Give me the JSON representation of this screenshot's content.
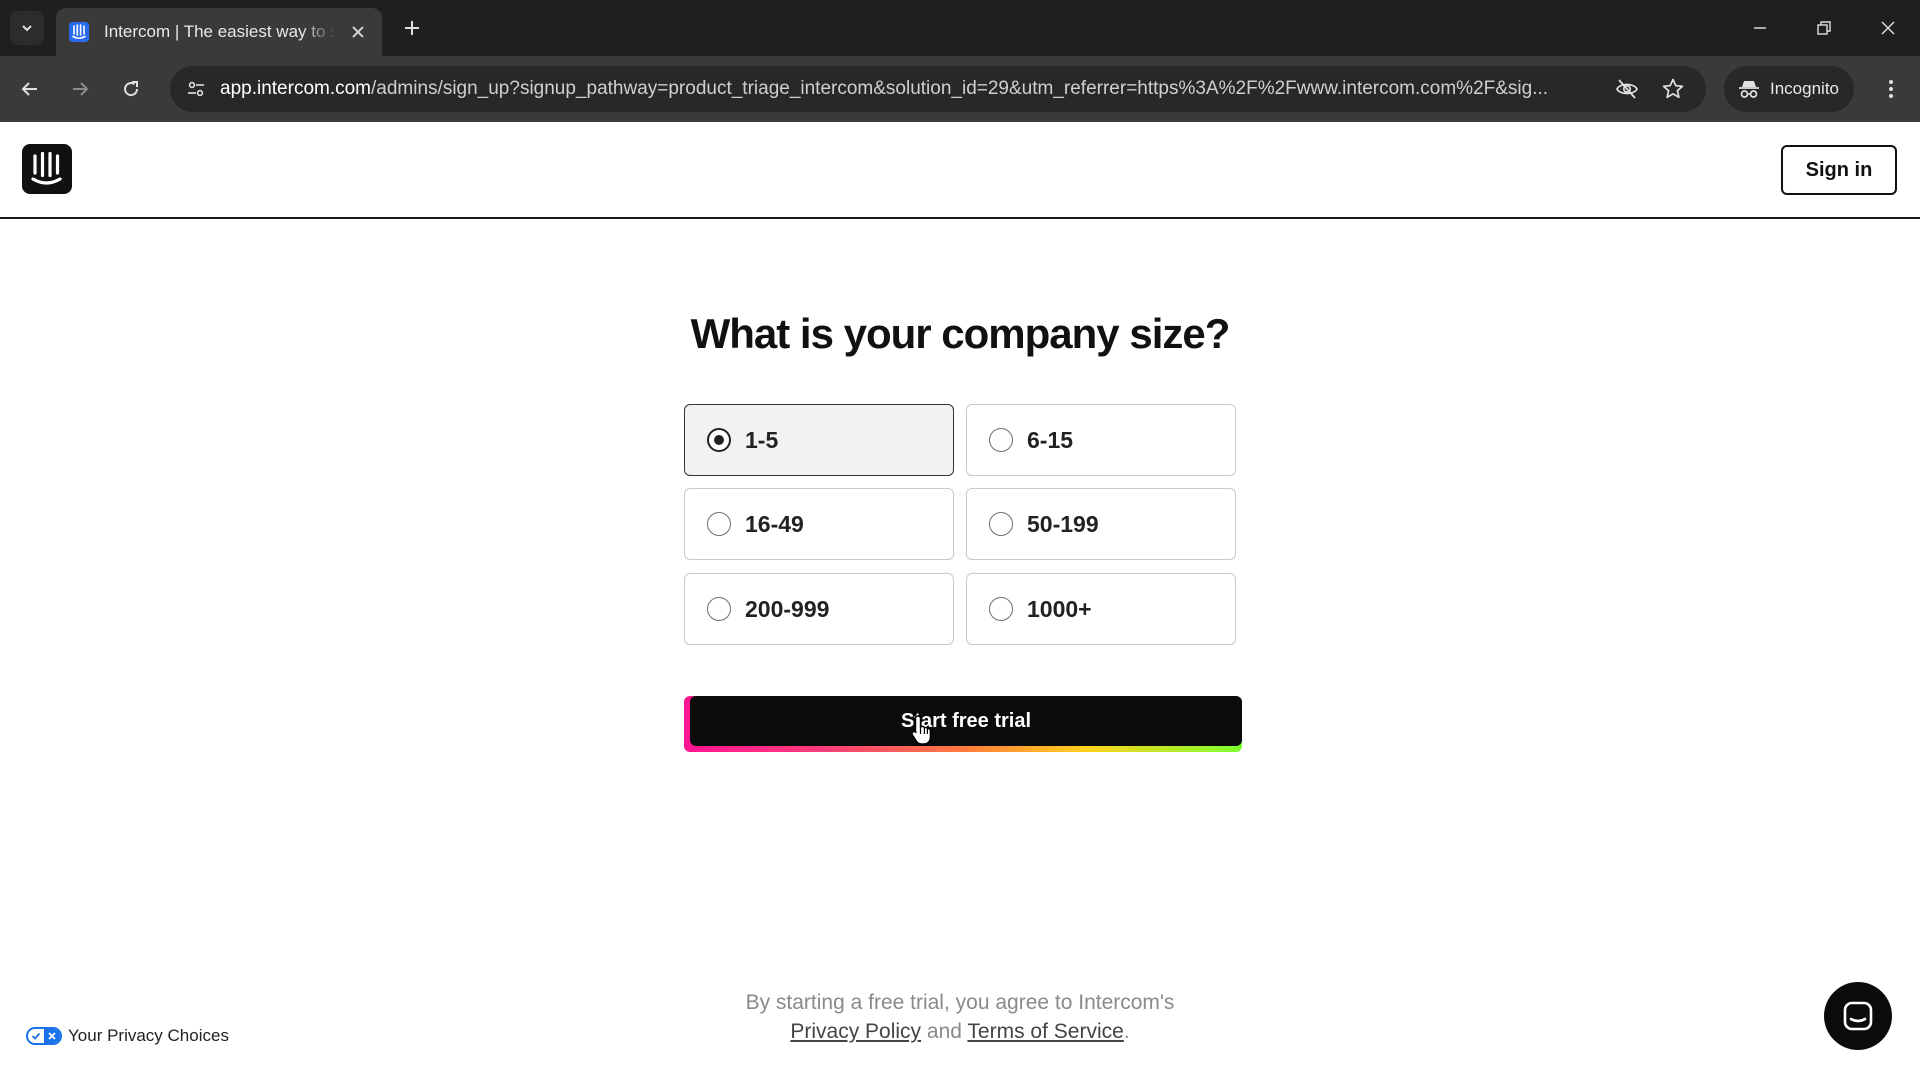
{
  "browser": {
    "tab": {
      "title": "Intercom | The easiest way to scale"
    },
    "url": {
      "host": "app.intercom.com",
      "path": "/admins/sign_up?signup_pathway=product_triage_intercom&solution_id=29&utm_referrer=https%3A%2F%2Fwww.intercom.com%2F&sig..."
    },
    "incognito_label": "Incognito",
    "icons": [
      "tab-search-icon",
      "intercom-favicon-icon",
      "close-icon",
      "plus-icon",
      "minimize-icon",
      "restore-icon",
      "back-icon",
      "forward-icon",
      "reload-icon",
      "site-info-icon",
      "eye-off-icon",
      "star-icon",
      "incognito-icon",
      "kebab-menu-icon"
    ]
  },
  "header": {
    "signin_label": "Sign in"
  },
  "main": {
    "question": "What is your company size?",
    "options": [
      {
        "label": "1-5",
        "selected": true
      },
      {
        "label": "6-15",
        "selected": false
      },
      {
        "label": "16-49",
        "selected": false
      },
      {
        "label": "50-199",
        "selected": false
      },
      {
        "label": "200-999",
        "selected": false
      },
      {
        "label": "1000+",
        "selected": false
      }
    ],
    "cta_label": "Start free trial"
  },
  "footer": {
    "legal_prefix": "By starting a free trial, you agree to Intercom's",
    "privacy_link": "Privacy Policy",
    "and": "and",
    "terms_link": "Terms of Service",
    "period": ".",
    "privacy_choices": "Your Privacy Choices"
  },
  "colors": {
    "page_bg": "#ffffff",
    "text": "#111111",
    "cta_bg": "#0b0b0b",
    "cta_gradient": [
      "#ff1493",
      "#ff7a3d",
      "#ffd21e",
      "#7cff2e"
    ],
    "privacy_blue": "#1a73e8"
  }
}
